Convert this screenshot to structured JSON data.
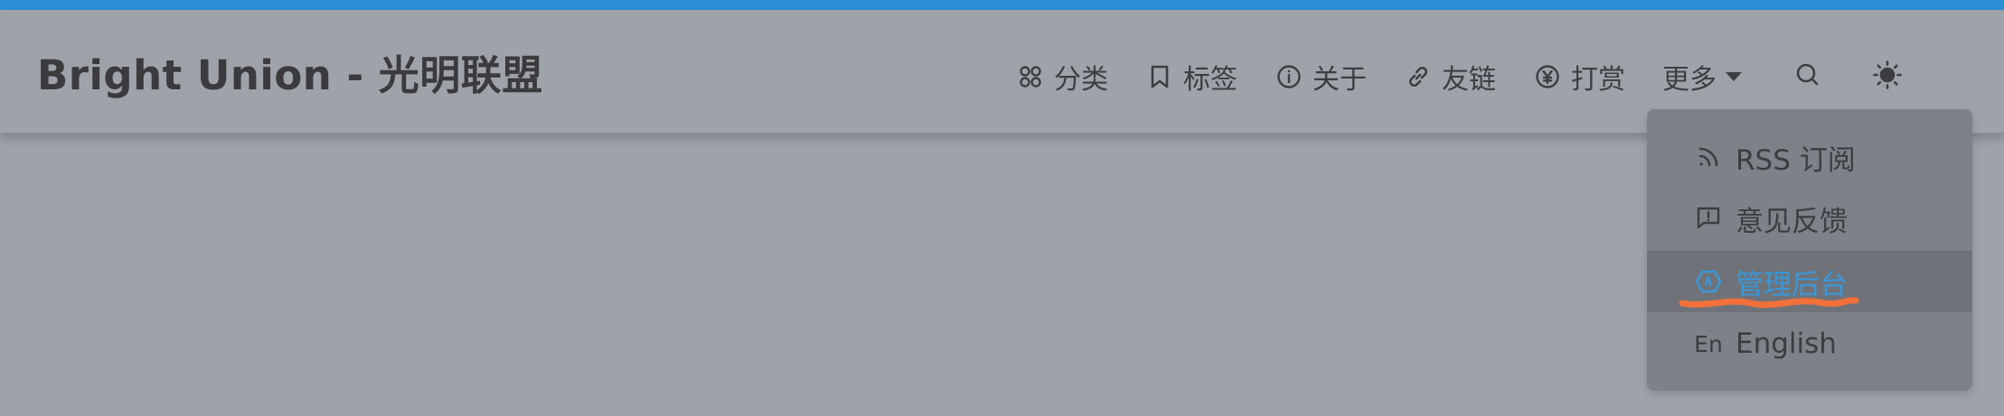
{
  "site": {
    "title": "Bright Union - 光明联盟"
  },
  "nav": {
    "items": [
      {
        "label": "分类",
        "icon": "categories-icon"
      },
      {
        "label": "标签",
        "icon": "bookmark-icon"
      },
      {
        "label": "关于",
        "icon": "info-icon"
      },
      {
        "label": "友链",
        "icon": "link-icon"
      },
      {
        "label": "打赏",
        "icon": "yen-coin-icon"
      },
      {
        "label": "更多",
        "icon": "chevron-down-icon"
      }
    ],
    "search_icon": "search-icon",
    "theme_icon": "sun-icon"
  },
  "dropdown": {
    "items": [
      {
        "label": "RSS 订阅",
        "icon": "rss-icon"
      },
      {
        "label": "意见反馈",
        "icon": "feedback-icon"
      },
      {
        "label": "管理后台",
        "icon": "admin-icon",
        "active": true
      },
      {
        "label": "English",
        "icon": "language-icon",
        "glyph": "En"
      }
    ]
  },
  "colors": {
    "accent_bar": "#2f8fd6",
    "active_item": "#3a97d8",
    "annotation_underline": "#f2703a",
    "background": "#9ea3aa",
    "dropdown_bg": "#7d8288"
  }
}
